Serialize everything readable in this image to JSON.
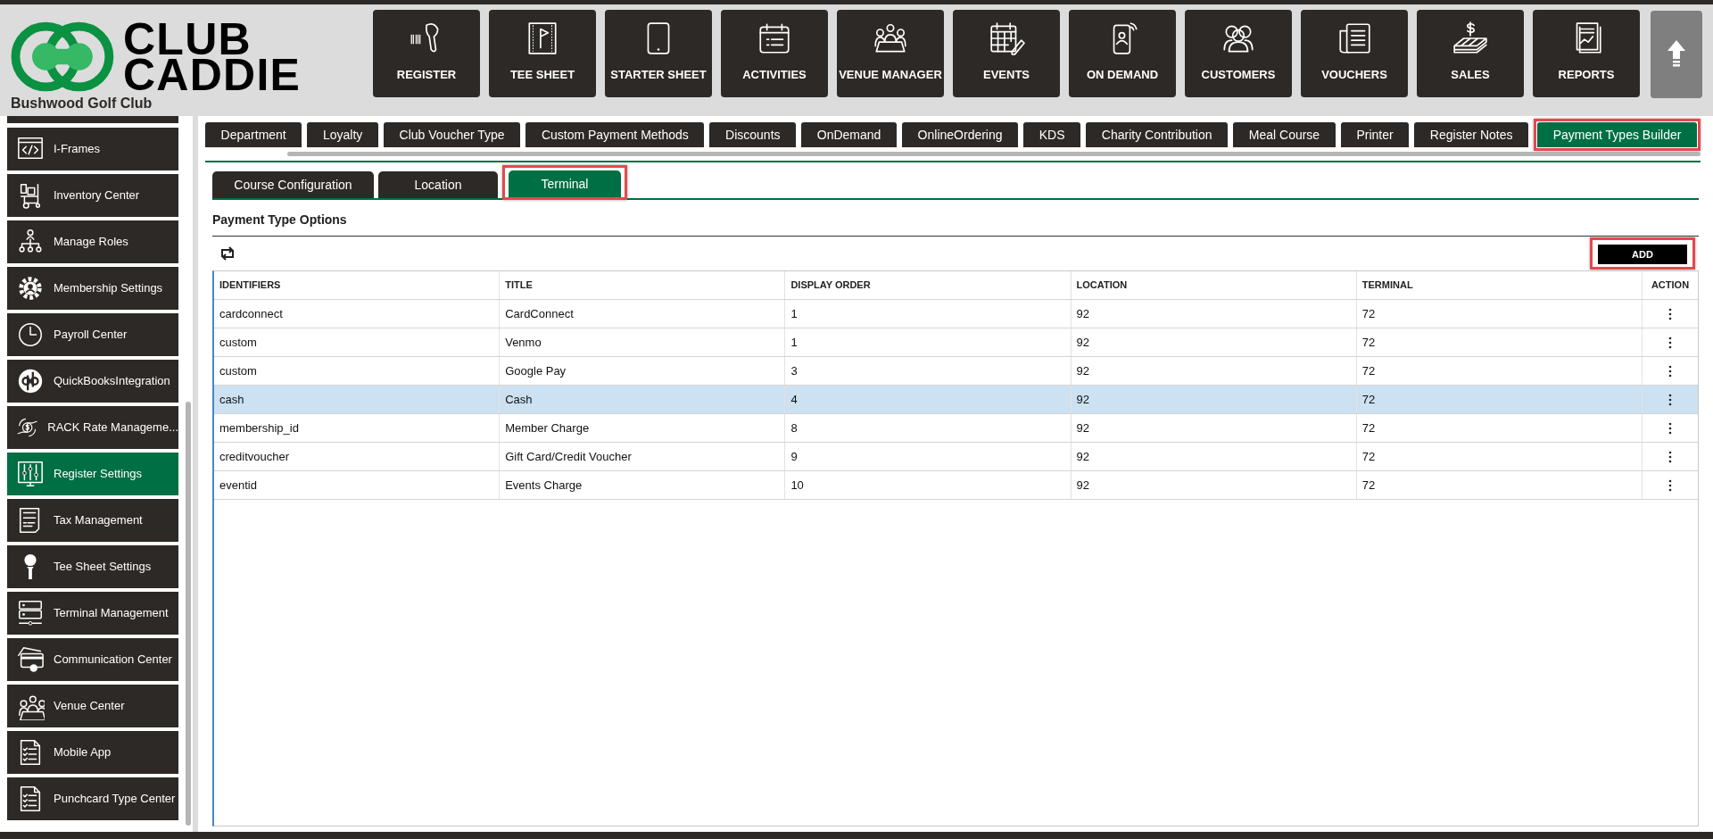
{
  "logo": {
    "line_1": "CLUB",
    "line_2": "CADDIE",
    "club_name": "Bushwood Golf Club"
  },
  "nav": [
    {
      "label": "REGISTER"
    },
    {
      "label": "TEE SHEET"
    },
    {
      "label": "STARTER SHEET"
    },
    {
      "label": "ACTIVITIES"
    },
    {
      "label": "VENUE MANAGER"
    },
    {
      "label": "EVENTS"
    },
    {
      "label": "ON DEMAND"
    },
    {
      "label": "CUSTOMERS"
    },
    {
      "label": "VOUCHERS"
    },
    {
      "label": "SALES"
    },
    {
      "label": "REPORTS"
    }
  ],
  "sidebar": {
    "items": [
      {
        "label": "I-Frames",
        "selected": false
      },
      {
        "label": "Inventory Center",
        "selected": false
      },
      {
        "label": "Manage Roles",
        "selected": false
      },
      {
        "label": "Membership Settings",
        "selected": false
      },
      {
        "label": "Payroll Center",
        "selected": false
      },
      {
        "label": "QuickBooksIntegration",
        "selected": false
      },
      {
        "label": "RACK Rate Manageme...",
        "selected": false
      },
      {
        "label": "Register Settings",
        "selected": true
      },
      {
        "label": "Tax Management",
        "selected": false
      },
      {
        "label": "Tee Sheet Settings",
        "selected": false
      },
      {
        "label": "Terminal Management",
        "selected": false
      },
      {
        "label": "Communication Center",
        "selected": false
      },
      {
        "label": "Venue Center",
        "selected": false
      },
      {
        "label": "Mobile App",
        "selected": false
      },
      {
        "label": "Punchcard Type Center",
        "selected": false
      }
    ]
  },
  "settings_tabs": [
    {
      "label": "Department",
      "selected": false,
      "highlighted": false
    },
    {
      "label": "Loyalty",
      "selected": false,
      "highlighted": false
    },
    {
      "label": "Club Voucher Type",
      "selected": false,
      "highlighted": false
    },
    {
      "label": "Custom Payment Methods",
      "selected": false,
      "highlighted": false
    },
    {
      "label": "Discounts",
      "selected": false,
      "highlighted": false
    },
    {
      "label": "OnDemand",
      "selected": false,
      "highlighted": false
    },
    {
      "label": "OnlineOrdering",
      "selected": false,
      "highlighted": false
    },
    {
      "label": "KDS",
      "selected": false,
      "highlighted": false
    },
    {
      "label": "Charity Contribution",
      "selected": false,
      "highlighted": false
    },
    {
      "label": "Meal Course",
      "selected": false,
      "highlighted": false
    },
    {
      "label": "Printer",
      "selected": false,
      "highlighted": false
    },
    {
      "label": "Register Notes",
      "selected": false,
      "highlighted": false
    },
    {
      "label": "Payment Types Builder",
      "selected": true,
      "highlighted": true
    }
  ],
  "sub_tabs": [
    {
      "label": "Course Configuration",
      "selected": false,
      "highlighted": false
    },
    {
      "label": "Location",
      "selected": false,
      "highlighted": false
    },
    {
      "label": "Terminal",
      "selected": true,
      "highlighted": true
    }
  ],
  "section": {
    "title": "Payment Type Options",
    "add_button": {
      "label": "ADD",
      "highlighted": true
    }
  },
  "table": {
    "columns": [
      "IDENTIFIERS",
      "TITLE",
      "DISPLAY ORDER",
      "LOCATION",
      "TERMINAL",
      "ACTION"
    ],
    "rows": [
      {
        "cells": [
          "cardconnect",
          "CardConnect",
          "1",
          "92",
          "72"
        ],
        "selected": false
      },
      {
        "cells": [
          "custom",
          "Venmo",
          "1",
          "92",
          "72"
        ],
        "selected": false
      },
      {
        "cells": [
          "custom",
          "Google Pay",
          "3",
          "92",
          "72"
        ],
        "selected": false
      },
      {
        "cells": [
          "cash",
          "Cash",
          "4",
          "92",
          "72"
        ],
        "selected": true
      },
      {
        "cells": [
          "membership_id",
          "Member Charge",
          "8",
          "92",
          "72"
        ],
        "selected": false
      },
      {
        "cells": [
          "creditvoucher",
          "Gift Card/Credit Voucher",
          "9",
          "92",
          "72"
        ],
        "selected": false
      },
      {
        "cells": [
          "eventid",
          "Events Charge",
          "10",
          "92",
          "72"
        ],
        "selected": false
      }
    ]
  }
}
